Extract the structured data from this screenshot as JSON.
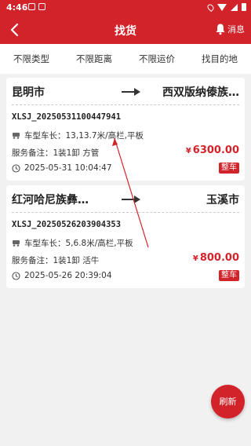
{
  "status_bar": {
    "time": "4:46"
  },
  "header": {
    "title": "找货",
    "messages_label": "消息"
  },
  "filters": [
    "不限类型",
    "不限距离",
    "不限运价",
    "找目的地"
  ],
  "cards": [
    {
      "from": "昆明市",
      "to": "西双版纳傣族…",
      "order_no": "XLSJ_20250531100447941",
      "spec": "车型车长：13,13.7米/高栏,平板",
      "remark": "服务备注：1装1卸 方管",
      "price_symbol": "¥",
      "price": "6300.00",
      "time": "2025-05-31 10:04:47",
      "badge": "整车"
    },
    {
      "from": "红河哈尼族彝…",
      "to": "玉溪市",
      "order_no": "XLSJ_20250526203904353",
      "spec": "车型车长：5,6.8米/高栏,平板",
      "remark": "服务备注：1装1卸 活牛",
      "price_symbol": "¥",
      "price": "800.00",
      "time": "2025-05-26 20:39:04",
      "badge": "整车"
    }
  ],
  "fab": {
    "label": "刷新"
  },
  "colors": {
    "brand": "#d3232a",
    "background": "#f1f1f1"
  },
  "icons": [
    "back-icon",
    "bell-icon",
    "arrow-right-icon",
    "truck-icon",
    "clock-icon"
  ]
}
